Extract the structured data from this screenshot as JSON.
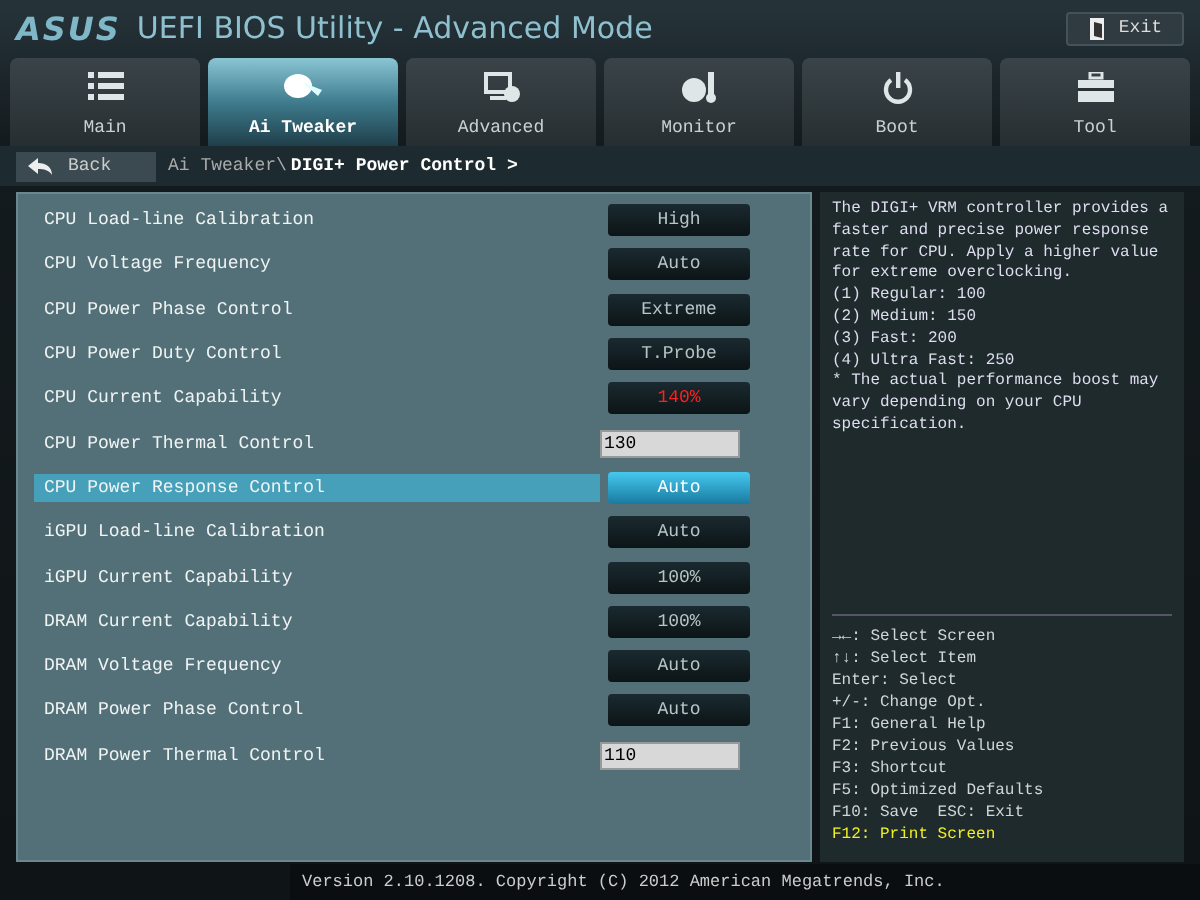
{
  "header": {
    "brand": "ASUS",
    "title": "UEFI BIOS Utility - Advanced Mode",
    "exit": "Exit"
  },
  "tabs": [
    {
      "label": "Main",
      "selected": false
    },
    {
      "label": "Ai Tweaker",
      "selected": true
    },
    {
      "label": "Advanced",
      "selected": false
    },
    {
      "label": "Monitor",
      "selected": false
    },
    {
      "label": "Boot",
      "selected": false
    },
    {
      "label": "Tool",
      "selected": false
    }
  ],
  "breadcrumb": {
    "back": "Back",
    "path": "Ai Tweaker\\",
    "current": "DIGI+ Power Control >"
  },
  "settings": [
    {
      "label": "CPU Load-line Calibration",
      "kind": "select",
      "value": "High",
      "warning": false,
      "selected": false
    },
    {
      "label": "CPU Voltage Frequency",
      "kind": "select",
      "value": "Auto",
      "warning": false,
      "selected": false
    },
    {
      "label": "CPU Power Phase Control",
      "kind": "select",
      "value": "Extreme",
      "warning": false,
      "selected": false
    },
    {
      "label": "CPU Power Duty Control",
      "kind": "select",
      "value": "T.Probe",
      "warning": false,
      "selected": false
    },
    {
      "label": "CPU Current Capability",
      "kind": "select",
      "value": "140%",
      "warning": true,
      "selected": false
    },
    {
      "label": "CPU Power Thermal Control",
      "kind": "input",
      "value": "130",
      "warning": false,
      "selected": false
    },
    {
      "label": "CPU Power Response Control",
      "kind": "select",
      "value": "Auto",
      "warning": false,
      "selected": true
    },
    {
      "label": "iGPU Load-line Calibration",
      "kind": "select",
      "value": "Auto",
      "warning": false,
      "selected": false
    },
    {
      "label": "iGPU Current Capability",
      "kind": "select",
      "value": "100%",
      "warning": false,
      "selected": false
    },
    {
      "label": "DRAM Current Capability",
      "kind": "select",
      "value": "100%",
      "warning": false,
      "selected": false
    },
    {
      "label": "DRAM Voltage Frequency",
      "kind": "select",
      "value": "Auto",
      "warning": false,
      "selected": false
    },
    {
      "label": "DRAM Power Phase Control",
      "kind": "select",
      "value": "Auto",
      "warning": false,
      "selected": false
    },
    {
      "label": "DRAM Power Thermal Control",
      "kind": "input",
      "value": "110",
      "warning": false,
      "selected": false
    }
  ],
  "help": {
    "lines": [
      "The DIGI+ VRM controller provides a",
      "faster and precise power response",
      "rate for CPU. Apply a higher value",
      "for extreme overclocking.",
      "(1) Regular: 100",
      "(2) Medium: 150",
      "(3) Fast: 200",
      "(4) Ultra Fast: 250",
      "* The actual performance boost may",
      "vary depending on your CPU",
      "specification."
    ]
  },
  "keys": [
    {
      "text": "→←: Select Screen",
      "highlight": false
    },
    {
      "text": "↑↓: Select Item",
      "highlight": false
    },
    {
      "text": "Enter: Select",
      "highlight": false
    },
    {
      "text": "+/-: Change Opt.",
      "highlight": false
    },
    {
      "text": "F1: General Help",
      "highlight": false
    },
    {
      "text": "F2: Previous Values",
      "highlight": false
    },
    {
      "text": "F3: Shortcut",
      "highlight": false
    },
    {
      "text": "F5: Optimized Defaults",
      "highlight": false
    },
    {
      "text": "F10: Save  ESC: Exit",
      "highlight": false
    },
    {
      "text": "F12: Print Screen",
      "highlight": true
    }
  ],
  "footer": "Version 2.10.1208. Copyright (C) 2012 American Megatrends, Inc."
}
